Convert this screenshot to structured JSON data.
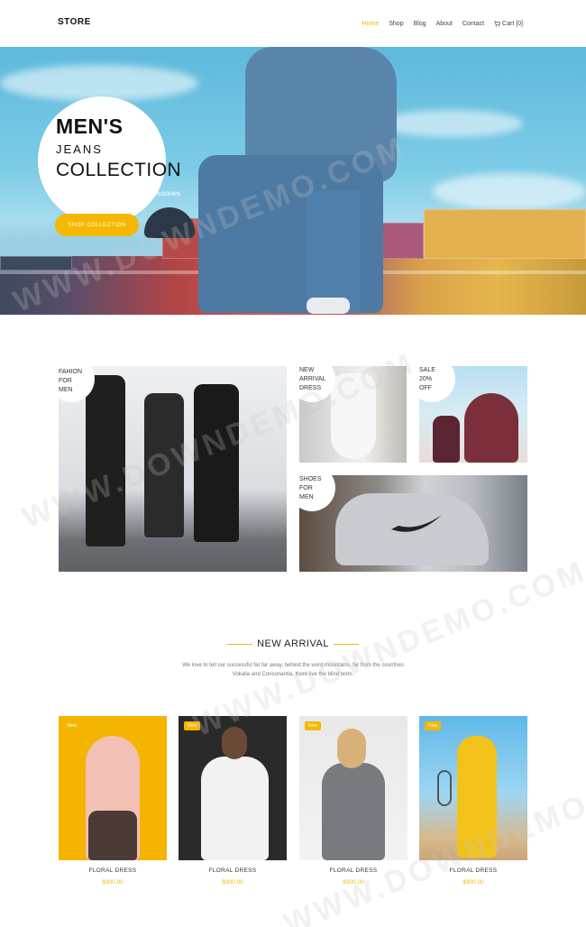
{
  "header": {
    "logo": "STORE",
    "nav": [
      "Home",
      "Shop",
      "Blog",
      "About",
      "Contact"
    ],
    "cart_label": "Cart [0]"
  },
  "hero": {
    "title_line1": "MEN'S",
    "title_line2": "JEANS",
    "title_line3": "COLLECTION",
    "subtitle": "New stylish shirts, pants & Accessories",
    "button": "SHOP COLLECTION"
  },
  "categories": {
    "fashion": [
      "FAHION",
      "FOR",
      "MEN"
    ],
    "arrival": [
      "NEW",
      "ARRIVAL",
      "DRESS"
    ],
    "sale": [
      "SALE",
      "20%",
      "OFF"
    ],
    "shoes": [
      "SHOES",
      "FOR",
      "MEN"
    ]
  },
  "new_arrival": {
    "title": "NEW ARRIVAL",
    "description": "We love to tell our successful far far away, behind the word mountains, far from the countries Vokalia and Consonantia, there live the blind texts."
  },
  "products": [
    {
      "badge": "New",
      "name": "FLORAL DRESS",
      "price": "$300.00"
    },
    {
      "badge": "New",
      "name": "FLORAL DRESS",
      "price": "$300.00"
    },
    {
      "badge": "New",
      "name": "FLORAL DRESS",
      "price": "$300.00"
    },
    {
      "badge": "New",
      "name": "FLORAL DRESS",
      "price": "$300.00"
    }
  ],
  "watermark": "WWW.DOWNDEMO.COM",
  "colors": {
    "accent": "#f5b700",
    "text": "#222222"
  }
}
